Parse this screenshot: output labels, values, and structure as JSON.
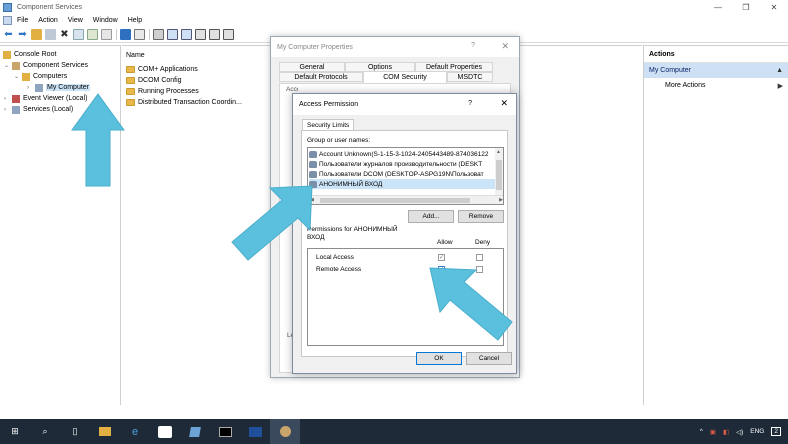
{
  "window": {
    "title": "Component Services"
  },
  "menu": [
    "File",
    "Action",
    "View",
    "Window",
    "Help"
  ],
  "tree": {
    "items": [
      {
        "label": "Console Root"
      },
      {
        "label": "Component Services"
      },
      {
        "label": "Computers"
      },
      {
        "label": "My Computer"
      },
      {
        "label": "Event Viewer (Local)"
      },
      {
        "label": "Services (Local)"
      }
    ]
  },
  "list": {
    "header": "Name",
    "rows": [
      "COM+ Applications",
      "DCOM Config",
      "Running Processes",
      "Distributed Transaction Coordin..."
    ]
  },
  "actions": {
    "header": "Actions",
    "section": "My Computer",
    "more": "More Actions"
  },
  "properties_dialog": {
    "title": "My Computer Properties",
    "help": "?",
    "close": "✕",
    "tabs_row1": [
      "General",
      "Options",
      "Default Properties"
    ],
    "tabs_row2": [
      "Default Protocols",
      "COM Security",
      "MSDTC"
    ],
    "section_fragment": "Access Permissions",
    "le_fragment": "Le"
  },
  "access_dialog": {
    "title": "Access Permission",
    "help": "?",
    "close": "✕",
    "tab": "Security Limits",
    "group_label": "Group or user names:",
    "users": [
      "Account Unknown(S-1-15-3-1024-2405443489-874036122",
      "Пользователи журналов производительности (DESKT",
      "Пользователи DCOM (DESKTOP-ASPG19N\\Пользоват",
      "АНОНИМНЫЙ ВХОД"
    ],
    "add": "Add...",
    "remove": "Remove",
    "perm_for": "Permissions for АНОНИМНЫЙ ВХОД",
    "col_allow": "Allow",
    "col_deny": "Deny",
    "perms": [
      {
        "name": "Local Access",
        "allow": true,
        "deny": false
      },
      {
        "name": "Remote Access",
        "allow": true,
        "deny": false
      }
    ],
    "ok": "OK",
    "cancel": "Cancel"
  },
  "taskbar": {
    "lang": "ENG",
    "notif_count": "2"
  },
  "colors": {
    "arrow": "#5bc0de",
    "selection": "#cce4f7",
    "taskbar": "#1e2a38"
  }
}
